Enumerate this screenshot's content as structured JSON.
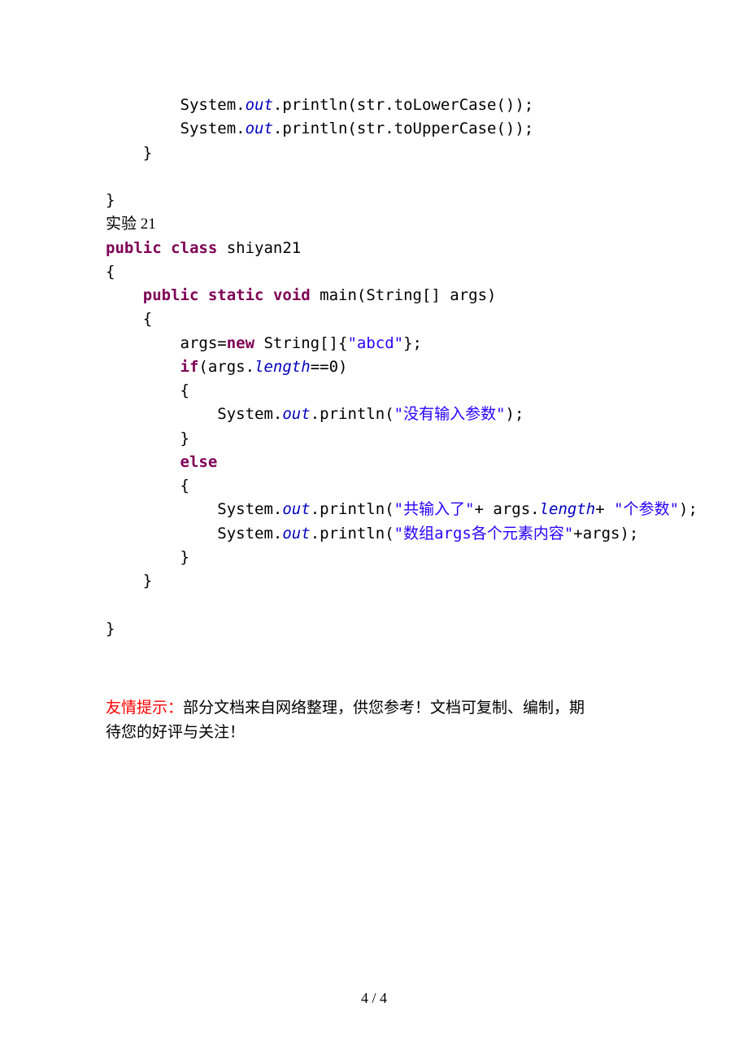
{
  "code": {
    "line1_indent": "        ",
    "line1_a": "System.",
    "line1_b": "out",
    "line1_c": ".println(str.toLowerCase());",
    "line2_a": "System.",
    "line2_b": "out",
    "line2_c": ".println(str.toUpperCase());",
    "line3": "    }",
    "line4": "",
    "line5": "}",
    "line6": "实验 21",
    "line7_a": "public",
    "line7_b": " ",
    "line7_c": "class",
    "line7_d": " shiyan21",
    "line8": "{",
    "line9_indent": "    ",
    "line9_a": "public",
    "line9_b": " ",
    "line9_c": "static",
    "line9_d": " ",
    "line9_e": "void",
    "line9_f": " main(String[] args)",
    "line10": "    {",
    "line11_indent": "        ",
    "line11_a": "args=",
    "line11_b": "new",
    "line11_c": " String[]{",
    "line11_d": "\"abcd\"",
    "line11_e": "};",
    "line12_a": "if",
    "line12_b": "(args.",
    "line12_c": "length",
    "line12_d": "==0)",
    "line13": "        {",
    "line14_indent": "            ",
    "line14_a": "System.",
    "line14_b": "out",
    "line14_c": ".println(",
    "line14_d": "\"没有输入参数\"",
    "line14_e": ");",
    "line15": "        }",
    "line16_indent": "        ",
    "line16_a": "else",
    "line17": "        {",
    "line18_indent": "            ",
    "line18_a": "System.",
    "line18_b": "out",
    "line18_c": ".println(",
    "line18_d": "\"共输入了\"",
    "line18_e": "+ args.",
    "line18_f": "length",
    "line18_g": "+ ",
    "line18_h": "\"个参数\"",
    "line18_i": ");",
    "line19_a": "System.",
    "line19_b": "out",
    "line19_c": ".println(",
    "line19_d": "\"数组args各个元素内容\"",
    "line19_e": "+args);",
    "line20": "        }",
    "line21": "    }",
    "line22": "",
    "line23": "}"
  },
  "note": {
    "prefix_indent": "        ",
    "red": "友情提示：",
    "rest1": "部分文档来自网络整理，供您参考！文档可复制、编制，期",
    "rest2": "待您的好评与关注！"
  },
  "footer": {
    "pagenum": "4 / 4"
  }
}
